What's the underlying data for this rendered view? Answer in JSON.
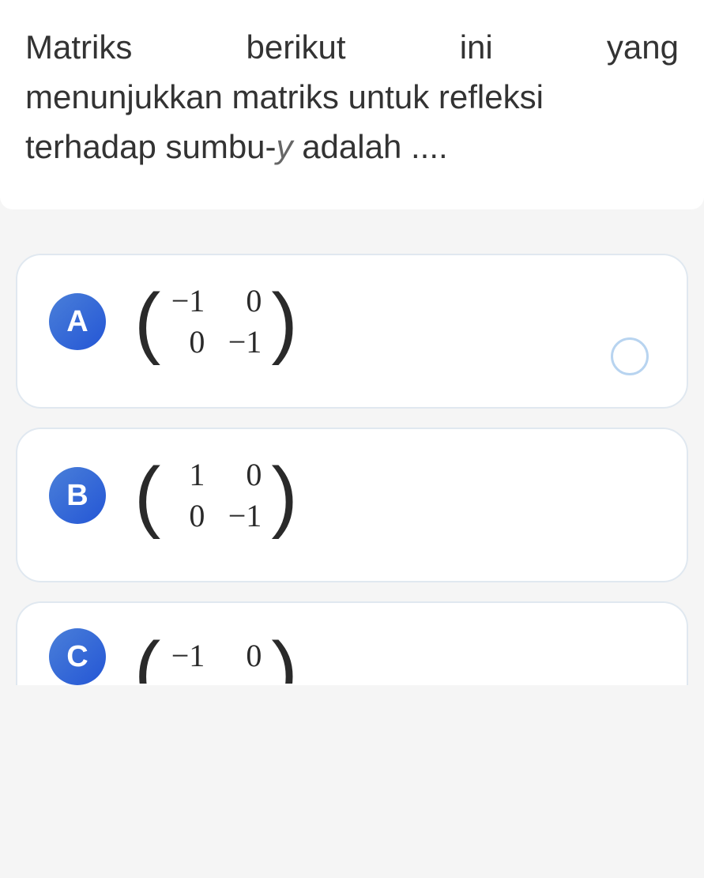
{
  "question": {
    "line1_part1": "Matriks",
    "line1_part2": "berikut",
    "line1_part3": "ini",
    "line1_part4": "yang",
    "line2": "menunjukkan matriks untuk refleksi",
    "line3_part1": "terhadap sumbu-",
    "line3_y": "y",
    "line3_part2": " adalah ...."
  },
  "options": {
    "a": {
      "label": "A",
      "matrix": {
        "r1c1": "−1",
        "r1c2": "0",
        "r2c1": "0",
        "r2c2": "−1"
      }
    },
    "b": {
      "label": "B",
      "matrix": {
        "r1c1": "1",
        "r1c2": "0",
        "r2c1": "0",
        "r2c2": "−1"
      }
    },
    "c": {
      "label": "C",
      "matrix": {
        "r1c1": "−1",
        "r1c2": "0"
      }
    }
  }
}
